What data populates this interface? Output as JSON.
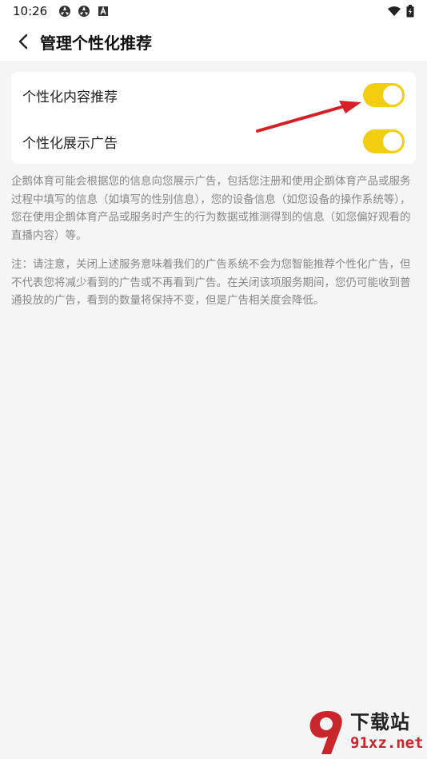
{
  "status_bar": {
    "time": "10:26",
    "icons": [
      "app-notification-icon",
      "app-notification-icon",
      "a-notification-icon"
    ],
    "right_icons": [
      "wifi-icon",
      "battery-icon"
    ]
  },
  "header": {
    "title": "管理个性化推荐"
  },
  "settings": [
    {
      "label": "个性化内容推荐",
      "enabled": true
    },
    {
      "label": "个性化展示广告",
      "enabled": true
    }
  ],
  "descriptions": {
    "info": "企鹅体育可能会根据您的信息向您展示广告，包括您注册和使用企鹅体育产品或服务过程中填写的信息（如填写的性别信息），您的设备信息（如您设备的操作系统等），您在使用企鹅体育产品或服务时产生的行为数据或推测得到的信息（如您偏好观看的直播内容）等。",
    "note": "注：请注意，关闭上述服务意味着我们的广告系统不会为您智能推荐个性化广告，但不代表您将减少看到的广告或不再看到广告。在关闭该项服务期间，您仍可能收到普通投放的广告，看到的数量将保持不变，但是广告相关度会降低。"
  },
  "colors": {
    "toggle_on": "#f3cd0f",
    "arrow": "#d71f26"
  },
  "watermark": {
    "text": "下载站",
    "url": "91xz.net"
  }
}
